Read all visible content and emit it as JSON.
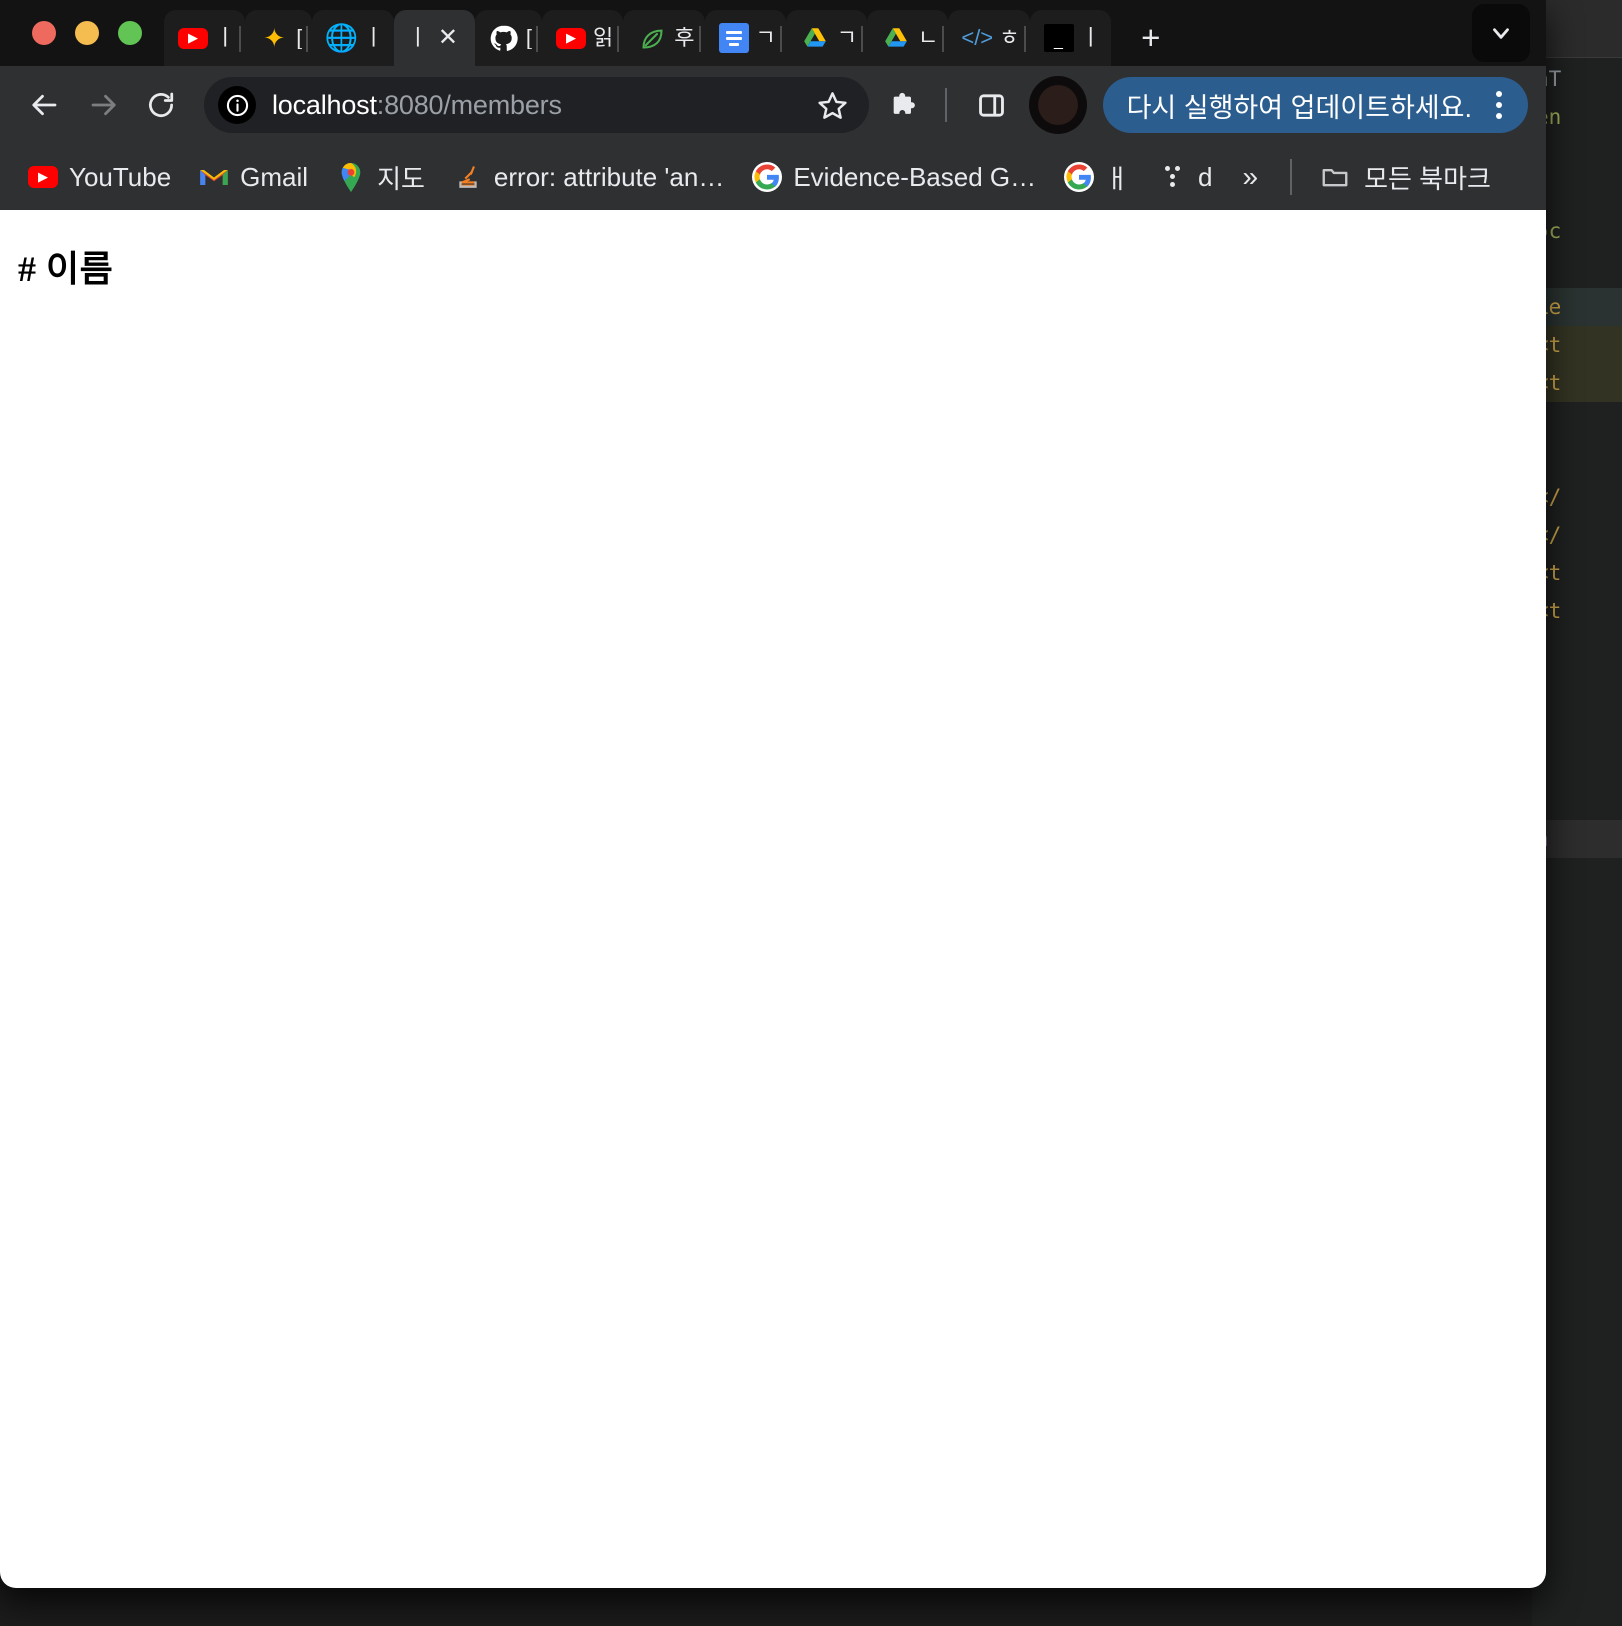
{
  "window": {
    "traffic_lights": [
      "close",
      "minimize",
      "zoom"
    ],
    "colors": {
      "tabstrip_bg": "#131313",
      "toolbar_bg": "#2f3032",
      "active_tab_bg": "#2f3032",
      "omnibox_bg": "#202124",
      "update_pill_bg": "#2c5d8f",
      "page_bg": "#ffffff",
      "traffic_red": "#ee6a5f",
      "traffic_yellow": "#f5bd4f",
      "traffic_green": "#61c454"
    }
  },
  "tabs": [
    {
      "icon": "youtube-icon",
      "label": "ㅣ",
      "active": false
    },
    {
      "icon": "sparkle-icon",
      "label": "[",
      "active": false
    },
    {
      "icon": "globe-icon",
      "label": "ㅣ",
      "active": false
    },
    {
      "icon": "page-icon",
      "label": "ㅣ",
      "active": true
    },
    {
      "icon": "github-icon",
      "label": "[",
      "active": false
    },
    {
      "icon": "youtube-icon",
      "label": "읽",
      "active": false
    },
    {
      "icon": "leaf-icon",
      "label": "후",
      "active": false
    },
    {
      "icon": "google-docs-icon",
      "label": "ㄱ",
      "active": false
    },
    {
      "icon": "google-drive-icon",
      "label": "ㄱ",
      "active": false
    },
    {
      "icon": "google-drive-icon",
      "label": "ㄴ",
      "active": false
    },
    {
      "icon": "code-icon",
      "label": "ㅎ",
      "active": false
    },
    {
      "icon": "terminal-icon",
      "label": "ㅣ",
      "active": false
    }
  ],
  "tabstrip": {
    "new_tab_label": "+",
    "tab_search_icon": "chevron-down-icon",
    "close_icon": "✕"
  },
  "toolbar": {
    "back_icon": "arrow-left-icon",
    "forward_icon": "arrow-right-icon",
    "reload_icon": "reload-icon",
    "site_info_icon": "info-circle-icon",
    "url_host": "localhost",
    "url_path": ":8080/members",
    "url_full": "localhost:8080/members",
    "bookmark_icon": "star-icon",
    "extensions_icon": "puzzle-icon",
    "side_panel_icon": "side-panel-icon",
    "avatar_icon": "avatar",
    "update_label": "다시 실행하여 업데이트하세요.",
    "update_menu_icon": "three-dots-vertical-icon"
  },
  "bookmarks": {
    "items": [
      {
        "icon": "youtube-icon",
        "label": "YouTube"
      },
      {
        "icon": "gmail-icon",
        "label": "Gmail"
      },
      {
        "icon": "maps-icon",
        "label": "지도"
      },
      {
        "icon": "stackoverflow-icon",
        "label": "error: attribute 'an…"
      },
      {
        "icon": "google-icon",
        "label": "Evidence-Based G…"
      },
      {
        "icon": "google-icon",
        "label": "ㅐ"
      },
      {
        "icon": "dots-grid-icon",
        "label": "d"
      }
    ],
    "overflow_label": "»",
    "all_bookmarks_label": "모든 북마크",
    "all_bookmarks_icon": "folder-icon"
  },
  "page": {
    "heading": "# 이름"
  },
  "background_ide": {
    "lines": [
      {
        "text": "nT",
        "class": "c-grey"
      },
      {
        "text": "en",
        "class": "c-olive"
      },
      {
        "text": "",
        "class": ""
      },
      {
        "text": "",
        "class": ""
      },
      {
        "text": "ɔc",
        "class": "c-olive"
      },
      {
        "text": "",
        "class": ""
      },
      {
        "text": "Le",
        "class": "c-gold"
      },
      {
        "text": "<t",
        "class": "c-gold"
      },
      {
        "text": "<t",
        "class": "c-gold"
      },
      {
        "text": "",
        "class": ""
      },
      {
        "text": "",
        "class": ""
      },
      {
        "text": "</",
        "class": "c-gold"
      },
      {
        "text": "</",
        "class": "c-gold"
      },
      {
        "text": "<t",
        "class": "c-gold"
      },
      {
        "text": "<t",
        "class": "c-gold"
      },
      {
        "text": "",
        "class": ""
      },
      {
        "text": "",
        "class": ""
      },
      {
        "text": "",
        "class": ""
      },
      {
        "text": "",
        "class": ""
      },
      {
        "text": "",
        "class": ""
      },
      {
        "text": "n",
        "class": "c-purple"
      },
      {
        "text": "",
        "class": ""
      },
      {
        "text": "",
        "class": ""
      },
      {
        "text": "",
        "class": ""
      },
      {
        "text": "",
        "class": ""
      },
      {
        "text": "",
        "class": ""
      },
      {
        "text": "",
        "class": ""
      },
      {
        "text": "",
        "class": ""
      }
    ]
  }
}
